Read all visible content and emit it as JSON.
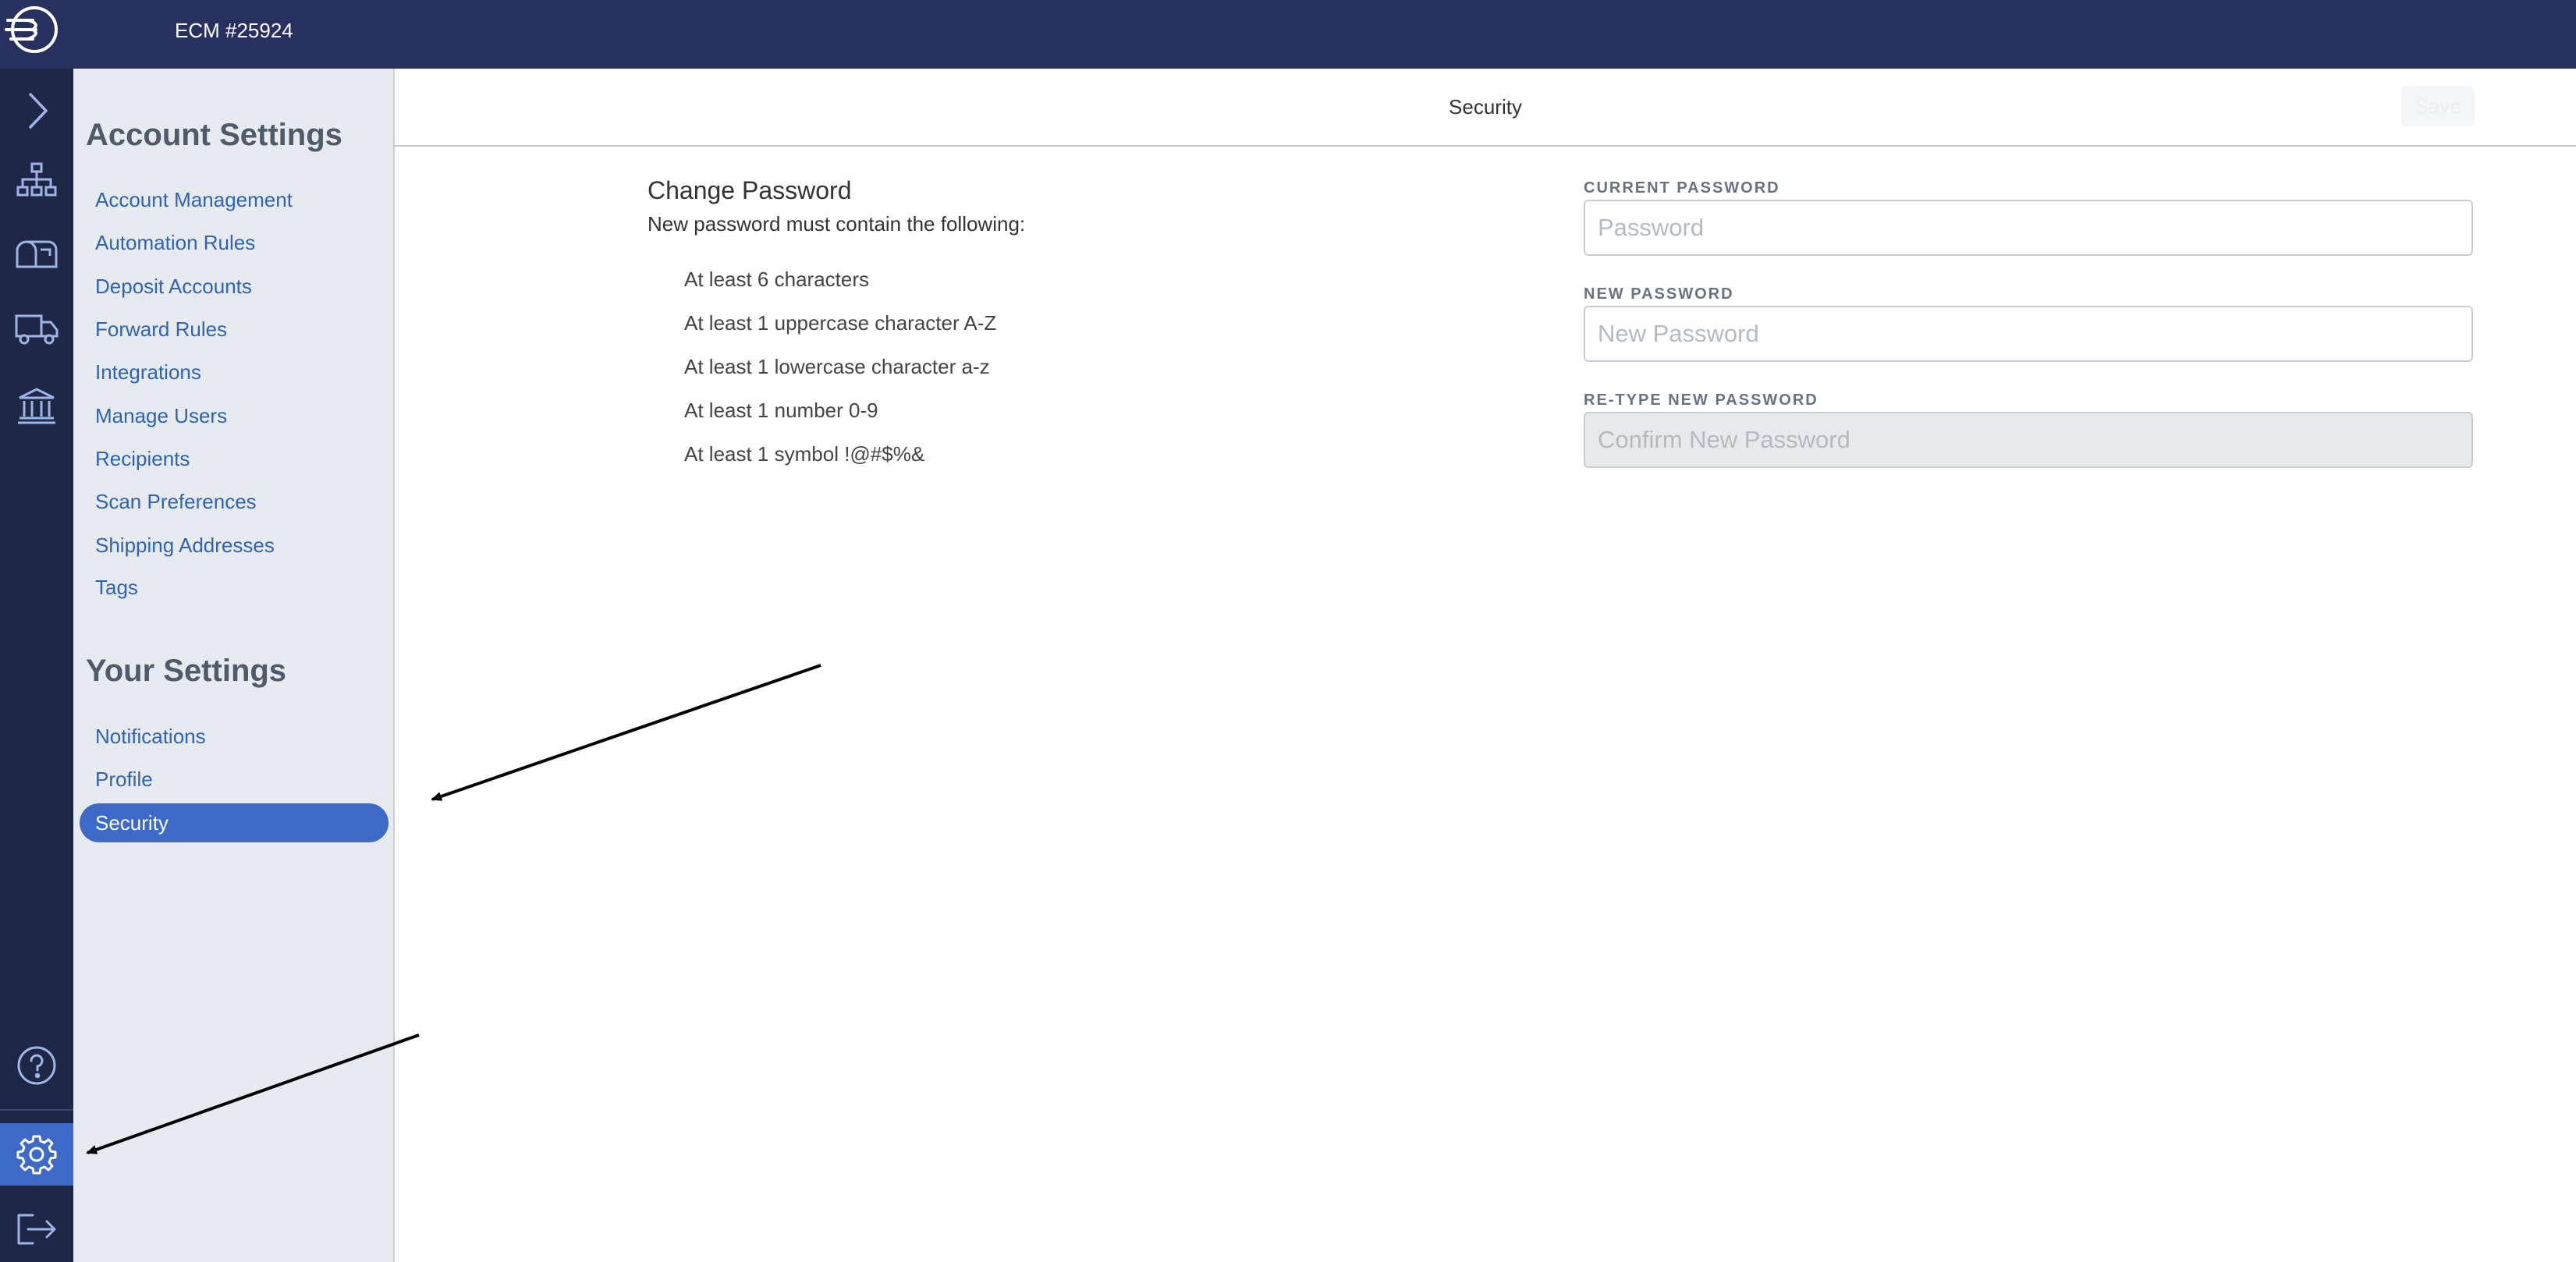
{
  "app": {
    "account_title": "ECM #25924",
    "logo_icon": "stamp-logo-icon"
  },
  "rail": {
    "items": [
      {
        "name": "expand-chevron-icon"
      },
      {
        "name": "sitemap-icon"
      },
      {
        "name": "mailbox-icon"
      },
      {
        "name": "delivery-truck-icon"
      },
      {
        "name": "bank-icon"
      }
    ],
    "bottom": [
      {
        "name": "help-icon"
      },
      {
        "name": "settings-gear-icon",
        "active": true
      },
      {
        "name": "logout-icon"
      }
    ]
  },
  "sidebar": {
    "account_heading": "Account Settings",
    "account_items": [
      {
        "label": "Account Management"
      },
      {
        "label": "Automation Rules"
      },
      {
        "label": "Deposit Accounts"
      },
      {
        "label": "Forward Rules"
      },
      {
        "label": "Integrations"
      },
      {
        "label": "Manage Users"
      },
      {
        "label": "Recipients"
      },
      {
        "label": "Scan Preferences"
      },
      {
        "label": "Shipping Addresses"
      },
      {
        "label": "Tags"
      }
    ],
    "your_heading": "Your Settings",
    "your_items": [
      {
        "label": "Notifications"
      },
      {
        "label": "Profile"
      },
      {
        "label": "Security",
        "active": true
      }
    ]
  },
  "header": {
    "title": "Security",
    "save_label": "Save"
  },
  "change_password": {
    "title": "Change Password",
    "subtitle": "New password must contain the following:",
    "rules": [
      "At least 6 characters",
      "At least 1 uppercase character A-Z",
      "At least 1 lowercase character a-z",
      "At least 1 number 0-9",
      "At least 1 symbol !@#$%&"
    ]
  },
  "form": {
    "current": {
      "label": "CURRENT PASSWORD",
      "placeholder": "Password",
      "value": ""
    },
    "new": {
      "label": "NEW PASSWORD",
      "placeholder": "New Password",
      "value": ""
    },
    "confirm": {
      "label": "RE-TYPE NEW PASSWORD",
      "placeholder": "Confirm New Password",
      "value": "",
      "disabled": true
    }
  },
  "colors": {
    "topbar": "#28305f",
    "rail": "#1f2747",
    "accent": "#3d69c9",
    "link": "#2e63b6",
    "sidebar_bg": "#e7eaef"
  }
}
